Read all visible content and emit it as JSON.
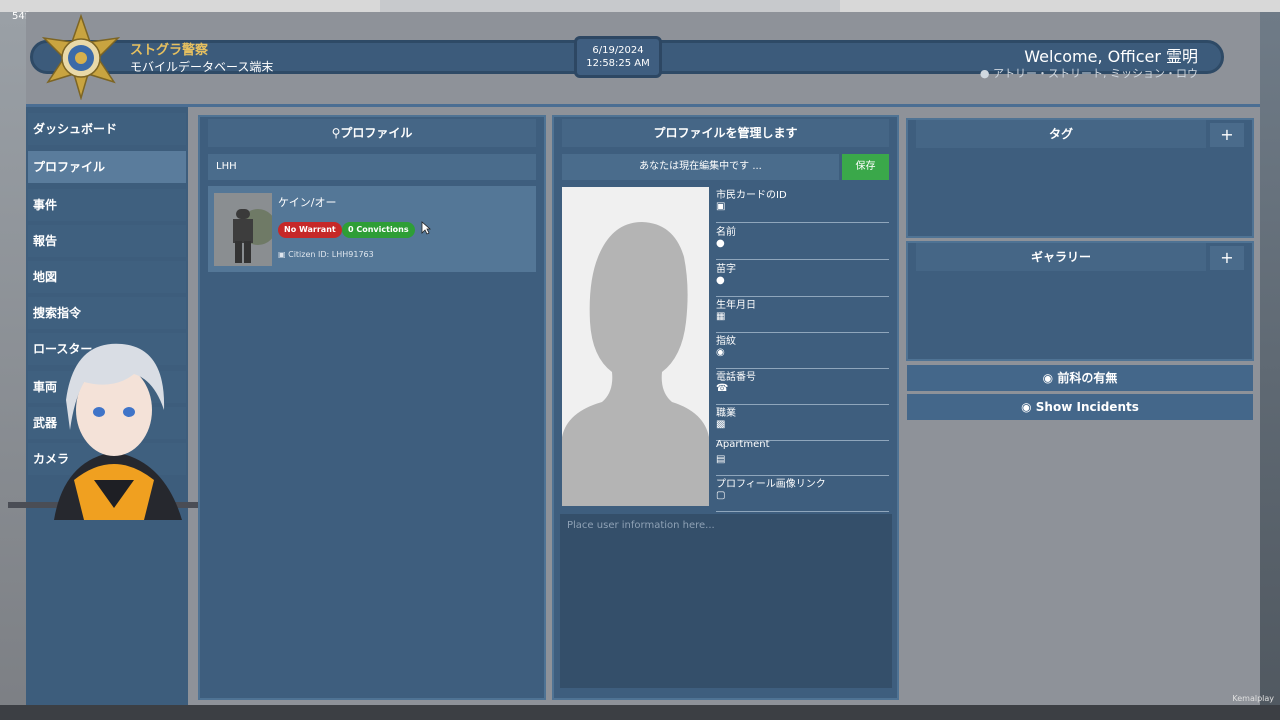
{
  "overlay": {
    "fps": "54fps"
  },
  "header": {
    "org_name": "ストグラ警察",
    "org_sub": "モバイルデータベース端末",
    "date": "6/19/2024",
    "time": "12:58:25 AM",
    "welcome": "Welcome, Officer 霊明",
    "location": "アトリー・ストリート, ミッション・ロウ"
  },
  "sidebar": {
    "items": [
      {
        "label": "ダッシュボード"
      },
      {
        "label": "プロファイル"
      },
      {
        "label": "事件"
      },
      {
        "label": "報告"
      },
      {
        "label": "地図"
      },
      {
        "label": "捜索指令"
      },
      {
        "label": "ロースター"
      },
      {
        "label": "車両"
      },
      {
        "label": "武器"
      },
      {
        "label": "カメラ"
      }
    ]
  },
  "profiles": {
    "title": "プロファイル",
    "search_value": "LHH",
    "result": {
      "name": "ケイン/オー",
      "warrant": "No Warrant",
      "convictions": "0 Convictions",
      "citizen_id": "Citizen ID: LHH91763"
    }
  },
  "manage": {
    "title": "プロファイルを管理します",
    "editing_status": "あなたは現在編集中です ...",
    "save_label": "保存",
    "fields": [
      {
        "label": "市民カードのID",
        "icon": "id-card-icon"
      },
      {
        "label": "名前",
        "icon": "user-icon"
      },
      {
        "label": "苗字",
        "icon": "user-icon"
      },
      {
        "label": "生年月日",
        "icon": "calendar-icon"
      },
      {
        "label": "指紋",
        "icon": "fingerprint-icon"
      },
      {
        "label": "電話番号",
        "icon": "phone-icon"
      },
      {
        "label": "職業",
        "icon": "briefcase-icon"
      },
      {
        "label": "Apartment",
        "icon": "building-icon"
      },
      {
        "label": "プロフィール画像リンク",
        "icon": "image-icon"
      }
    ],
    "notes_placeholder": "Place user information here..."
  },
  "tags": {
    "title": "タグ",
    "add": "+"
  },
  "gallery": {
    "title": "ギャラリー",
    "add": "+"
  },
  "buttons": {
    "criminal_record": "前科の有無",
    "show_incidents": "Show Incidents"
  },
  "watermark": "Kemalplay",
  "colors": {
    "accent": "#3d5d7c",
    "save": "#3aa84a",
    "warrant": "#c62828",
    "convictions": "#2e9e36",
    "title_gold": "#e6c060"
  }
}
